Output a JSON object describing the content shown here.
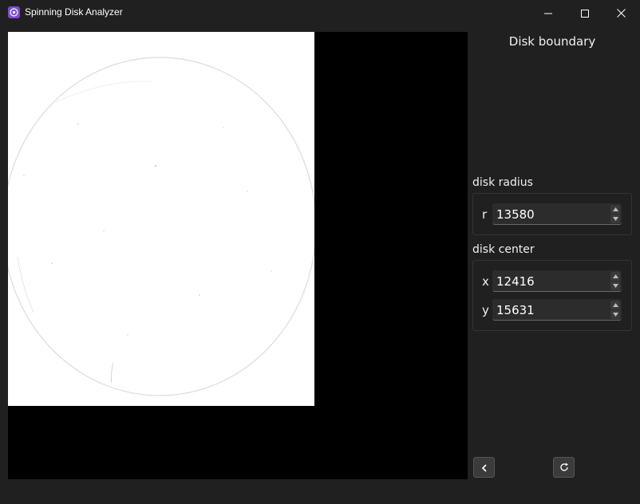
{
  "window": {
    "title": "Spinning Disk Analyzer",
    "icons": {
      "app": "disk-app-icon",
      "minimize": "minimize-icon",
      "maximize": "maximize-icon",
      "close": "close-icon"
    }
  },
  "panel": {
    "title": "Disk boundary",
    "radius_group": {
      "label": "disk radius",
      "r": {
        "label": "r",
        "value": "13580"
      }
    },
    "center_group": {
      "label": "disk center",
      "x": {
        "label": "x",
        "value": "12416"
      },
      "y": {
        "label": "y",
        "value": "15631"
      }
    },
    "nav": {
      "back_icon": "chevron-left-icon",
      "reset_icon": "refresh-icon"
    }
  },
  "colors": {
    "window_bg": "#202020",
    "viewer_bg": "#000000",
    "scan_bg": "#ffffff",
    "app_icon": "#7b4bd6"
  }
}
